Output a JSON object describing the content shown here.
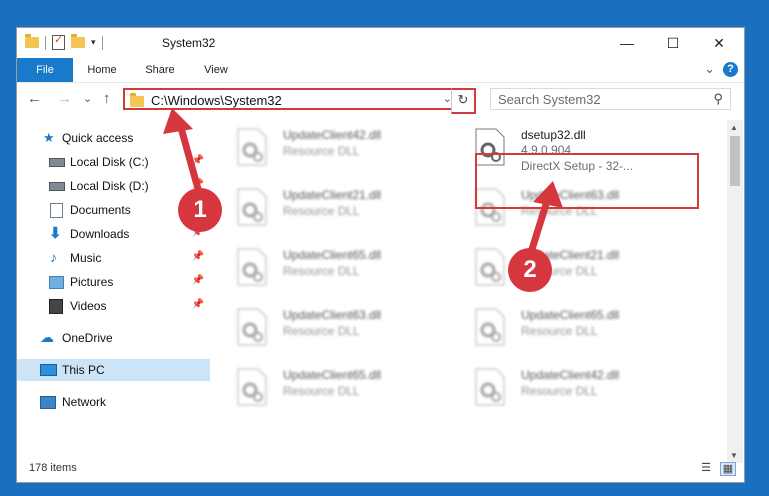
{
  "window": {
    "title": "System32",
    "minimize_glyph": "—",
    "maximize_glyph": "☐",
    "close_glyph": "✕"
  },
  "ribbon": {
    "tabs": [
      "File",
      "Home",
      "Share",
      "View"
    ],
    "expand_glyph": "⌄",
    "help_glyph": "?"
  },
  "navbar": {
    "back_glyph": "←",
    "forward_glyph": "→",
    "recent_glyph": "⌄",
    "up_glyph": "↑",
    "address": "C:\\Windows\\System32",
    "address_dropdown_glyph": "⌄",
    "refresh_glyph": "↻",
    "search_placeholder": "Search System32",
    "search_glyph": "⚲"
  },
  "sidebar": {
    "items": [
      {
        "label": "Quick access",
        "icon": "star-icon",
        "pinned": false
      },
      {
        "label": "Local Disk (C:)",
        "icon": "drive-icon",
        "pinned": true
      },
      {
        "label": "Local Disk (D:)",
        "icon": "drive-icon",
        "pinned": true
      },
      {
        "label": "Documents",
        "icon": "documents-icon",
        "pinned": true
      },
      {
        "label": "Downloads",
        "icon": "download-icon",
        "pinned": true
      },
      {
        "label": "Music",
        "icon": "music-icon",
        "pinned": true
      },
      {
        "label": "Pictures",
        "icon": "pictures-icon",
        "pinned": true
      },
      {
        "label": "Videos",
        "icon": "videos-icon",
        "pinned": true
      },
      {
        "label": "OneDrive",
        "icon": "cloud-icon",
        "pinned": false
      },
      {
        "label": "This PC",
        "icon": "computer-icon",
        "pinned": false,
        "selected": true
      },
      {
        "label": "Network",
        "icon": "network-icon",
        "pinned": false
      }
    ],
    "pin_glyph": "📌"
  },
  "files": {
    "left_column": [
      {
        "name": "UpdateClient42.dll",
        "desc": "Resource DLL"
      },
      {
        "name": "UpdateClient21.dll",
        "desc": "Resource DLL"
      },
      {
        "name": "UpdateClient65.dll",
        "desc": "Resource DLL"
      },
      {
        "name": "UpdateClient63.dll",
        "desc": "Resource DLL"
      },
      {
        "name": "UpdateClient65.dll",
        "desc": "Resource DLL"
      }
    ],
    "right_column": [
      {
        "name": "dsetup32.dll",
        "desc": "4.9.0.904",
        "desc2": "DirectX Setup - 32-...",
        "highlighted": true
      },
      {
        "name": "UpdateClient63.dll",
        "desc": "Resource DLL"
      },
      {
        "name": "UpdateClient21.dll",
        "desc": "Resource DLL"
      },
      {
        "name": "UpdateClient65.dll",
        "desc": "Resource DLL"
      },
      {
        "name": "UpdateClient42.dll",
        "desc": "Resource DLL"
      }
    ]
  },
  "status": {
    "item_count": "178 items"
  },
  "annotations": {
    "step1": "1",
    "step2": "2",
    "color": "#d6373e"
  }
}
